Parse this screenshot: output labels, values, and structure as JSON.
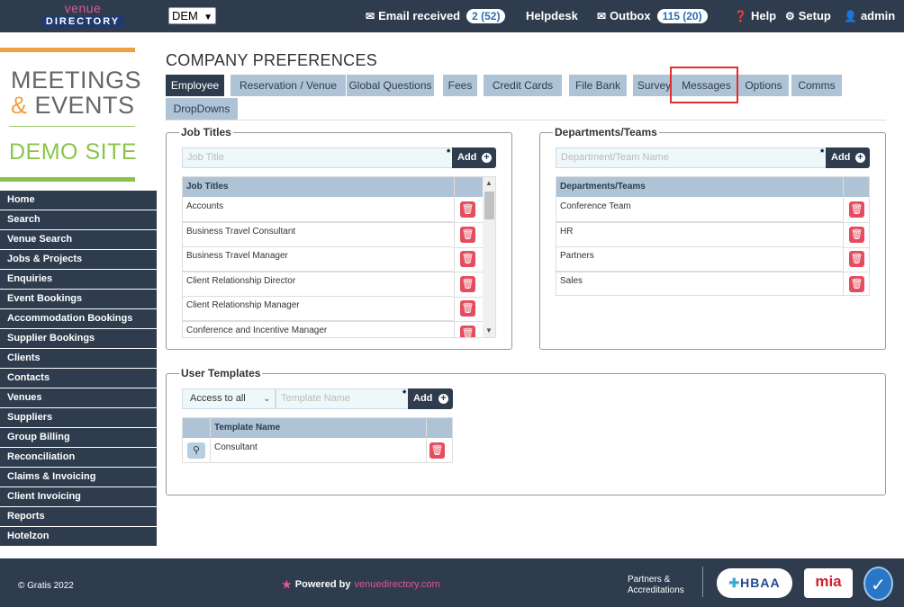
{
  "topbar": {
    "logo_top": "venue",
    "logo_bottom": "DIRECTORY",
    "site_select": "DEM",
    "email_label": "Email received",
    "email_badge": "2 (52)",
    "helpdesk": "Helpdesk",
    "outbox_label": "Outbox",
    "outbox_badge": "115 (20)",
    "help": "Help",
    "setup": "Setup",
    "user": "admin"
  },
  "brand": {
    "line1": "MEETINGS",
    "amp": "&",
    "line2": " EVENTS",
    "site": "DEMO SITE"
  },
  "sidebar": {
    "items": [
      "Home",
      "Search",
      "Venue Search",
      "Jobs & Projects",
      "Enquiries",
      "Event Bookings",
      "Accommodation Bookings",
      "Supplier Bookings",
      "Clients",
      "Contacts",
      "Venues",
      "Suppliers",
      "Group Billing",
      "Reconciliation",
      "Claims & Invoicing",
      "Client Invoicing",
      "Reports",
      "Hotelzon"
    ]
  },
  "page": {
    "title": "COMPANY PREFERENCES"
  },
  "tabs": [
    "Employee",
    "Reservation / Venue",
    "Global Questions",
    "Fees",
    "Credit Cards",
    "File Bank",
    "Survey",
    "Messages",
    "Options",
    "Comms",
    "DropDowns"
  ],
  "job_titles": {
    "legend": "Job Titles",
    "placeholder": "Job Title",
    "required": "*",
    "add": "Add",
    "header": "Job Titles",
    "rows": [
      "Accounts",
      "Business Travel Consultant",
      "Business Travel Manager",
      "Client Relationship Director",
      "Client Relationship Manager",
      "Conference and Incentive Manager"
    ]
  },
  "departments": {
    "legend": "Departments/Teams",
    "placeholder": "Department/Team Name",
    "required": "*",
    "add": "Add",
    "header": "Departments/Teams",
    "rows": [
      "Conference Team",
      "HR",
      "Partners",
      "Sales"
    ]
  },
  "user_templates": {
    "legend": "User Templates",
    "access_select": "Access to all",
    "placeholder": "Template Name",
    "required": "*",
    "add": "Add",
    "header": "Template Name",
    "rows": [
      "Consultant"
    ]
  },
  "footer": {
    "copyright": "© Gratis 2022",
    "powered_by": "Powered by",
    "powered_brand": "venuedirectory.com",
    "partners_line1": "Partners &",
    "partners_line2": "Accreditations",
    "hbaa": "HBAA",
    "mia": "mia"
  },
  "colors": {
    "navy": "#2e3c4e",
    "tab_light": "#aec4d6",
    "delete_red": "#e34d5e",
    "highlight_red": "#e32e2e",
    "brand_orange": "#f0a040",
    "brand_green": "#8bc34a",
    "brand_pink": "#e0559a"
  },
  "icons": {
    "email": "envelope-icon",
    "outbox": "envelope-icon",
    "help": "question-circle-icon",
    "setup": "gear-icon",
    "user": "user-icon",
    "add": "plus-circle-icon",
    "delete": "trash-icon",
    "view": "binoculars-icon"
  }
}
